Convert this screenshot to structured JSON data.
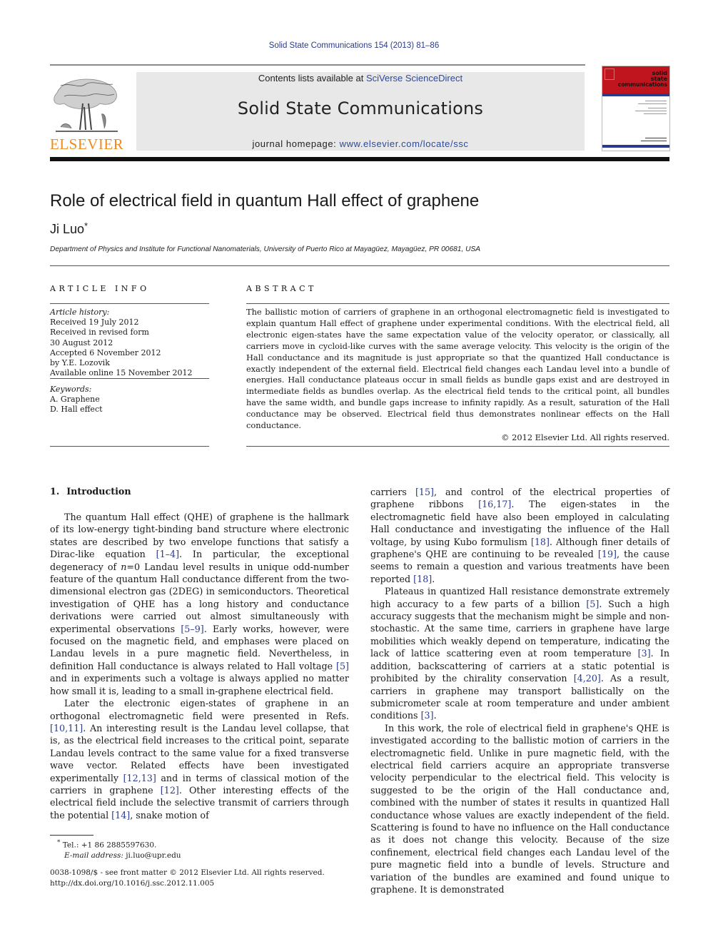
{
  "header": {
    "citation": "Solid State Communications 154 (2013) 81–86",
    "publisher_logo_text": "ELSEVIER",
    "contents_prefix": "Contents lists available at ",
    "contents_link": "SciVerse ScienceDirect",
    "journal_title": "Solid State Communications",
    "homepage_prefix": "journal homepage: ",
    "homepage_link": "www.elsevier.com/locate/ssc",
    "cover": {
      "line1": "solid",
      "line2": "state",
      "line3": "communications",
      "red": "#c0141f",
      "blue": "#2a3a8c"
    }
  },
  "colors": {
    "link": "#2a3a8c",
    "elsevier_orange": "#f08a1c",
    "banner_bg": "#e8e8e8"
  },
  "article": {
    "title": "Role of electrical field in quantum Hall effect of graphene",
    "author": "Ji Luo",
    "author_mark": "*",
    "affiliation": "Department of Physics and Institute for Functional Nanomaterials, University of Puerto Rico at Mayagüez, Mayagüez, PR 00681, USA"
  },
  "article_info": {
    "heading": "ARTICLE INFO",
    "history_label": "Article history:",
    "history": [
      "Received 19 July 2012",
      "Received in revised form",
      "30 August 2012",
      "Accepted 6 November 2012",
      "by Y.E. Lozovik",
      "Available online 15 November 2012"
    ],
    "keywords_label": "Keywords:",
    "keywords": [
      "A. Graphene",
      "D. Hall effect"
    ]
  },
  "abstract": {
    "heading": "ABSTRACT",
    "text": "The ballistic motion of carriers of graphene in an orthogonal electromagnetic field is investigated to explain quantum Hall effect of graphene under experimental conditions. With the electrical field, all electronic eigen-states have the same expectation value of the velocity operator, or classically, all carriers move in cycloid-like curves with the same average velocity. This velocity is the origin of the Hall conductance and its magnitude is just appropriate so that the quantized Hall conductance is exactly independent of the external field. Electrical field changes each Landau level into a bundle of energies. Hall conductance plateaus occur in small fields as bundle gaps exist and are destroyed in intermediate fields as bundles overlap. As the electrical field tends to the critical point, all bundles have the same width, and bundle gaps increase to infinity rapidly. As a result, saturation of the Hall conductance may be observed. Electrical field thus demonstrates nonlinear effects on the Hall conductance.",
    "copyright": "© 2012 Elsevier Ltd. All rights reserved."
  },
  "body": {
    "section_number": "1.",
    "section_title": "Introduction",
    "left_paragraphs": [
      [
        {
          "t": "The quantum Hall effect (QHE) of graphene is the hallmark of its low-energy tight-binding band structure where electronic states are described by two envelope functions that satisfy a Dirac-like equation "
        },
        {
          "r": "[1–4]"
        },
        {
          "t": ". In particular, the exceptional degeneracy of "
        },
        {
          "i": "n"
        },
        {
          "t": "=0 Landau level results in unique odd-number feature of the quantum Hall conductance different from the two-dimensional electron gas (2DEG) in semiconductors. Theoretical investigation of QHE has a long history and conductance derivations were carried out almost simultaneously with experimental observations "
        },
        {
          "r": "[5–9]"
        },
        {
          "t": ". Early works, however, were focused on the magnetic field, and emphases were placed on Landau levels in a pure magnetic field. Nevertheless, in definition Hall conductance is always related to Hall voltage "
        },
        {
          "r": "[5]"
        },
        {
          "t": " and in experiments such a voltage is always applied no matter how small it is, leading to a small in-graphene electrical field."
        }
      ],
      [
        {
          "t": "Later the electronic eigen-states of graphene in an orthogonal electromagnetic field were presented in Refs. "
        },
        {
          "r": "[10,11]"
        },
        {
          "t": ". An interesting result is the Landau level collapse, that is, as the electrical field increases to the critical point, separate Landau levels contract to the same value for a fixed transverse wave vector. Related effects have been investigated experimentally "
        },
        {
          "r": "[12,13]"
        },
        {
          "t": " and in terms of classical motion of the carriers in graphene "
        },
        {
          "r": "[12]"
        },
        {
          "t": ". Other interesting effects of the electrical field include the selective transmit of carriers through the potential "
        },
        {
          "r": "[14]"
        },
        {
          "t": ", snake motion of"
        }
      ]
    ],
    "right_paragraphs": [
      [
        {
          "t": "carriers "
        },
        {
          "r": "[15]"
        },
        {
          "t": ", and control of the electrical properties of graphene ribbons "
        },
        {
          "r": "[16,17]"
        },
        {
          "t": ". The eigen-states in the electromagnetic field have also been employed in calculating Hall conductance and investigating the influence of the Hall voltage, by using Kubo formulism "
        },
        {
          "r": "[18]"
        },
        {
          "t": ". Although finer details of graphene's QHE are continuing to be revealed "
        },
        {
          "r": "[19]"
        },
        {
          "t": ", the cause seems to remain a question and various treatments have been reported "
        },
        {
          "r": "[18]"
        },
        {
          "t": "."
        }
      ],
      [
        {
          "t": "Plateaus in quantized Hall resistance demonstrate extremely high accuracy to a few parts of a billion "
        },
        {
          "r": "[5]"
        },
        {
          "t": ". Such a high accuracy suggests that the mechanism might be simple and non-stochastic. At the same time, carriers in graphene have large mobilities which weakly depend on temperature, indicating the lack of lattice scattering even at room temperature "
        },
        {
          "r": "[3]"
        },
        {
          "t": ". In addition, backscattering of carriers at a static potential is prohibited by the chirality conservation "
        },
        {
          "r": "[4,20]"
        },
        {
          "t": ". As a result, carriers in graphene may transport ballistically on the submicrometer scale at room temperature and under ambient conditions "
        },
        {
          "r": "[3]"
        },
        {
          "t": "."
        }
      ],
      [
        {
          "t": "In this work, the role of electrical field in graphene's QHE is investigated according to the ballistic motion of carriers in the electromagnetic field. Unlike in pure magnetic field, with the electrical field carriers acquire an appropriate transverse velocity perpendicular to the electrical field. This velocity is suggested to be the origin of the Hall conductance and, combined with the number of states it results in quantized Hall conductance whose values are exactly independent of the field. Scattering is found to have no influence on the Hall conductance as it does not change this velocity. Because of the size confinement, electrical field changes each Landau level of the pure magnetic field into a bundle of levels. Structure and variation of the bundles are examined and found unique to graphene. It is demonstrated"
        }
      ]
    ]
  },
  "footnote": {
    "mark": "*",
    "tel": "Tel.: +1 86 2885597630.",
    "email_label": "E-mail address:",
    "email": "ji.luo@upr.edu"
  },
  "front_matter": {
    "issn_line": "0038-1098/$ - see front matter © 2012 Elsevier Ltd. All rights reserved.",
    "doi": "http://dx.doi.org/10.1016/j.ssc.2012.11.005"
  }
}
